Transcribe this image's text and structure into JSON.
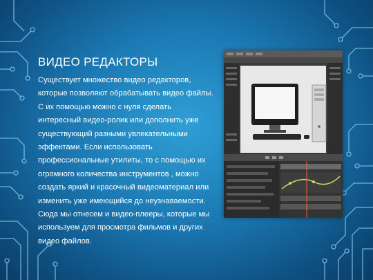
{
  "slide": {
    "title": "ВИДЕО РЕДАКТОРЫ",
    "lines": [
      "Существует множество видео редакторов,",
      "которые позволяют обрабатывать видео файлы.",
      "С их помощью можно с нуля сделать",
      "интересный видео-ролик или дополнить уже",
      "существующий разными увлекательными",
      "эффектами. Если использовать",
      "профессиональные утилиты, то с помощью их",
      "огромного количества инструментов , можно",
      "создать яркий и красочный видеоматериал или",
      "изменить уже имеющийся до неузнаваемости.",
      "Сюда мы отнесем и видео-плееры, которые мы",
      "используем для просмотра фильмов и других",
      "видео файлов."
    ]
  },
  "colors": {
    "background": "#1b78b2",
    "text": "#ffffff",
    "circuit": "#8fd4f2",
    "editor_dark": "#3a3a3a",
    "timeline_accent": "#c7e060"
  },
  "image": {
    "description_icon": "video-editor-screenshot"
  }
}
